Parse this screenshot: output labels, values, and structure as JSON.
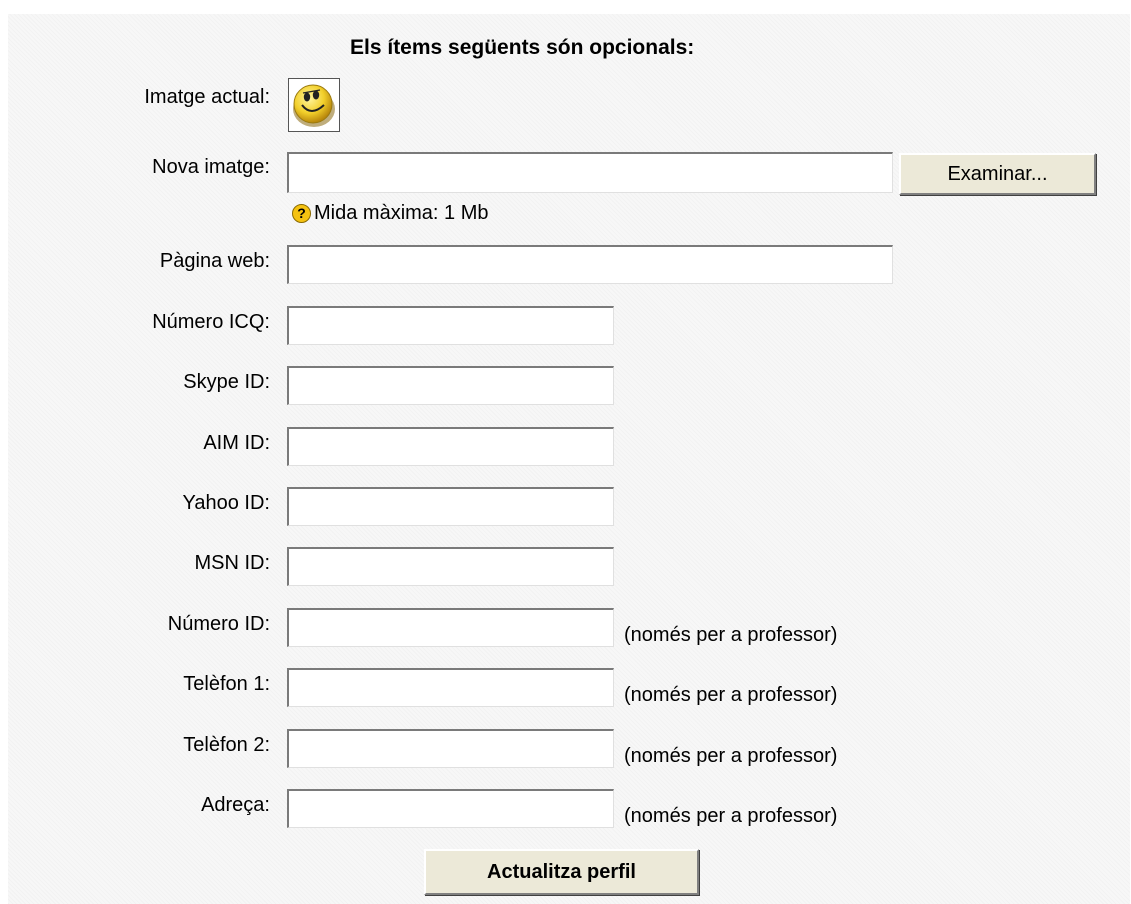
{
  "heading": "Els ítems següents són opcionals:",
  "current_image": {
    "label": "Imatge actual:",
    "icon": "smiley-face-icon"
  },
  "new_image": {
    "label": "Nova imatge:",
    "value": "",
    "browse_label": "Examinar...",
    "help_icon": "question-mark-icon",
    "max_size_text": "Mida màxima: 1  Mb"
  },
  "fields": [
    {
      "key": "web_page",
      "label": "Pàgina web:",
      "value": ""
    },
    {
      "key": "icq",
      "label": "Número ICQ:",
      "value": ""
    },
    {
      "key": "skype",
      "label": "Skype ID:",
      "value": ""
    },
    {
      "key": "aim",
      "label": "AIM ID:",
      "value": ""
    },
    {
      "key": "yahoo",
      "label": "Yahoo ID:",
      "value": ""
    },
    {
      "key": "msn",
      "label": "MSN ID:",
      "value": ""
    },
    {
      "key": "id_number",
      "label": "Número ID:",
      "value": "",
      "note": "(només per a professor)"
    },
    {
      "key": "phone1",
      "label": "Telèfon 1:",
      "value": "",
      "note": "(només per a professor)"
    },
    {
      "key": "phone2",
      "label": "Telèfon 2:",
      "value": "",
      "note": "(només per a professor)"
    },
    {
      "key": "address",
      "label": "Adreça:",
      "value": "",
      "note": "(només per a professor)"
    }
  ],
  "submit_label": "Actualitza perfil",
  "colors": {
    "panel_bg": "#f7f7f7",
    "button_bg": "#ece9d8",
    "help_icon": "#f5c211"
  }
}
